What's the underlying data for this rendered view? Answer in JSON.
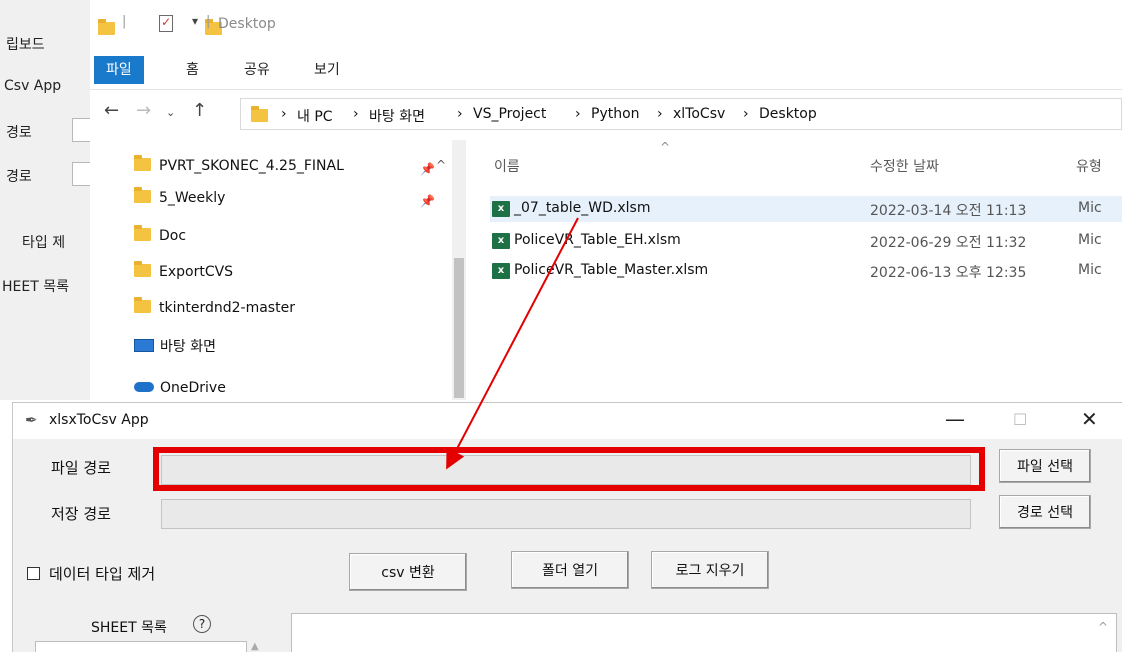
{
  "background_window": {
    "labels": [
      "립보드",
      "Csv App",
      "경로",
      "경로",
      "타입 제",
      "HEET 목록"
    ]
  },
  "explorer": {
    "title": "Desktop",
    "ribbon_tabs": [
      "파일",
      "홈",
      "공유",
      "보기"
    ],
    "breadcrumb": [
      "내 PC",
      "바탕 화면",
      "VS_Project",
      "Python",
      "xlToCsv",
      "Desktop"
    ],
    "nav_items": [
      {
        "label": "PVRT_SKONEC_4.25_FINAL",
        "icon": "folder-icon",
        "pinned": true
      },
      {
        "label": "5_Weekly",
        "icon": "folder-icon",
        "pinned": true
      },
      {
        "label": "Doc",
        "icon": "folder-icon",
        "pinned": false
      },
      {
        "label": "ExportCVS",
        "icon": "folder-icon",
        "pinned": false
      },
      {
        "label": "tkinterdnd2-master",
        "icon": "folder-icon",
        "pinned": false
      },
      {
        "label": "바탕 화면",
        "icon": "desktop-icon",
        "pinned": false
      },
      {
        "label": "OneDrive",
        "icon": "cloud-icon",
        "pinned": false
      }
    ],
    "columns": {
      "name": "이름",
      "date": "수정한 날짜",
      "type": "유형"
    },
    "files": [
      {
        "name": "_07_table_WD.xlsm",
        "date": "2022-03-14 오전 11:13",
        "type": "Mic",
        "selected": true
      },
      {
        "name": "PoliceVR_Table_EH.xlsm",
        "date": "2022-06-29 오전 11:32",
        "type": "Mic",
        "selected": false
      },
      {
        "name": "PoliceVR_Table_Master.xlsm",
        "date": "2022-06-13 오후 12:35",
        "type": "Mic",
        "selected": false
      }
    ]
  },
  "app": {
    "title": "xlsxToCsv App",
    "file_path_label": "파일 경로",
    "save_path_label": "저장 경로",
    "file_select_button": "파일 선택",
    "path_select_button": "경로 선택",
    "remove_type_checkbox": "데이터 타입 제거",
    "convert_button": "csv 변환",
    "open_folder_button": "폴더 열기",
    "clear_log_button": "로그 지우기",
    "sheet_list_label": "SHEET 목록",
    "help_symbol": "?"
  },
  "colors": {
    "highlight": "#e40000",
    "arrow": "#e40000",
    "ribbon_active": "#1979ca",
    "excel_icon": "#1e7145"
  }
}
